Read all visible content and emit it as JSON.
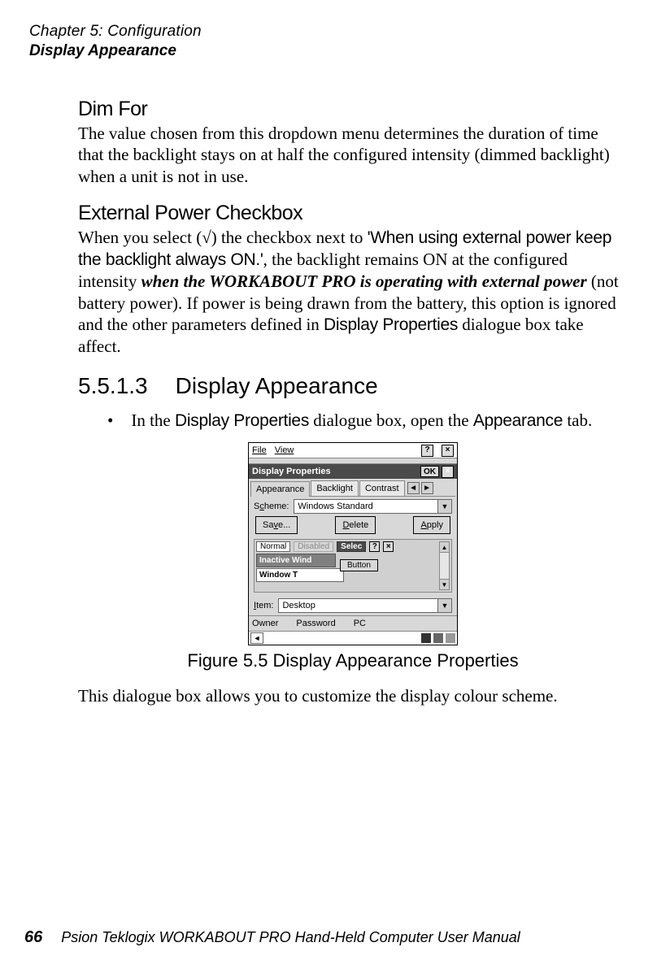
{
  "header": {
    "chapter": "Chapter 5: Configuration",
    "section": "Display Appearance"
  },
  "dimfor": {
    "heading": "Dim For",
    "body": "The value chosen from this dropdown menu determines the duration of time that the backlight stays on at half the configured intensity (dimmed backlight) when a unit is not in use."
  },
  "extpower": {
    "heading": "External Power Checkbox",
    "body_pre": "When you select (√) the checkbox next to ",
    "quote": "'When using external power keep the backlight always ON.'",
    "mid": ", the backlight remains ON at the configured intensity ",
    "emph": "when the WORKABOUT PRO is operating with external power",
    "post1": " (not battery power). If power is being drawn from the battery, this option is ignored and the other parameters defined in ",
    "dp": "Display Properties",
    "post2": " dialogue box take affect."
  },
  "numbered": {
    "num": "5.5.1.3",
    "title": "Display Appearance"
  },
  "bullet": {
    "pre": "In the ",
    "dp": "Display Properties",
    "mid": " dialogue box, open the ",
    "ap": "Appearance",
    "post": " tab."
  },
  "screenshot": {
    "menu_file": "File",
    "menu_view": "View",
    "title": "Display Properties",
    "ok": "OK",
    "x": "×",
    "q": "?",
    "tab_appearance": "Appearance",
    "tab_backlight": "Backlight",
    "tab_contrast": "Contrast",
    "scheme_label_pre": "S",
    "scheme_label_u": "c",
    "scheme_label_post": "heme:",
    "scheme_value": "Windows Standard",
    "save_pre": "Sa",
    "save_u": "v",
    "save_post": "e...",
    "delete_u": "D",
    "delete_post": "elete",
    "apply_u": "A",
    "apply_post": "pply",
    "pv_normal": "Normal",
    "pv_disabled": "Disabled",
    "pv_selected": "Selec",
    "pv_inactive": "Inactive Wind",
    "pv_window": "Window T",
    "pv_button": "Button",
    "item_label_u": "I",
    "item_label_post": "tem:",
    "item_value": "Desktop",
    "task_owner": "Owner",
    "task_password": "Password",
    "task_pc": "PC",
    "arrow_left": "◄",
    "arrow_right": "►",
    "tri_down": "▼",
    "tri_up": "▲"
  },
  "figure_caption": "Figure 5.5 Display Appearance Properties",
  "closing": "This dialogue box allows you to customize the display colour scheme.",
  "footer": {
    "page": "66",
    "text": "Psion Teklogix WORKABOUT PRO Hand-Held Computer User Manual"
  }
}
